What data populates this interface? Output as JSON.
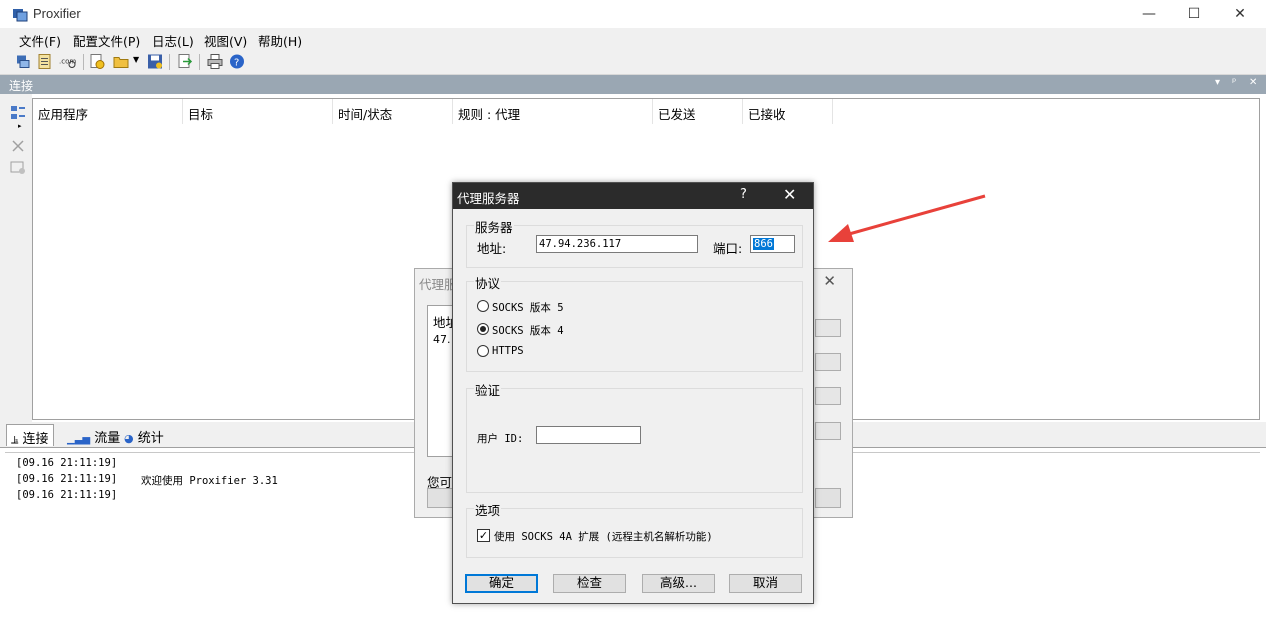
{
  "app": {
    "title": "Proxifier",
    "window_controls": [
      "—",
      "☐",
      "✕"
    ]
  },
  "menu": [
    "文件(F)",
    "配置文件(P)",
    "日志(L)",
    "视图(V)",
    "帮助(H)"
  ],
  "panel": {
    "title": "连接",
    "controls": [
      "▾",
      "ᵖ",
      "✕"
    ],
    "columns": [
      "应用程序",
      "目标",
      "时间/状态",
      "规则 : 代理",
      "已发送",
      "已接收"
    ]
  },
  "bottom_tabs": [
    "连接",
    "流量",
    "统计"
  ],
  "log": [
    {
      "time": "[09.16 21:11:19]",
      "message": ""
    },
    {
      "time": "[09.16 21:11:19]",
      "message": "欢迎使用 Proxifier 3.31"
    },
    {
      "time": "[09.16 21:11:19]",
      "message": ""
    }
  ],
  "bg_dialog": {
    "title": "代理服",
    "list_header": "地址",
    "list_value": "47.",
    "footer_text": "您可"
  },
  "dialog": {
    "title": "代理服务器",
    "help": "?",
    "close": "✕",
    "server_group": "服务器",
    "address_label": "地址:",
    "address_value": "47.94.236.117",
    "port_label": "端口:",
    "port_value": "866",
    "protocol_group": "协议",
    "protocols": [
      {
        "label": "SOCKS 版本 5",
        "selected": false
      },
      {
        "label": "SOCKS 版本 4",
        "selected": true
      },
      {
        "label": "HTTPS",
        "selected": false
      }
    ],
    "auth_group": "验证",
    "user_id_label": "用户 ID:",
    "user_id_value": "",
    "options_group": "选项",
    "option_socks4a_label": "使用 SOCKS 4A 扩展 (远程主机名解析功能)",
    "option_socks4a_checked": true,
    "check_mark": "✓",
    "buttons": {
      "ok": "确定",
      "check": "检查",
      "advanced": "高级...",
      "cancel": "取消"
    }
  },
  "colors": {
    "panel_header": "#9aa7b3",
    "dialog_titlebar": "#2b2b2b",
    "selection": "#0078d7",
    "arrow": "#e8413a"
  }
}
